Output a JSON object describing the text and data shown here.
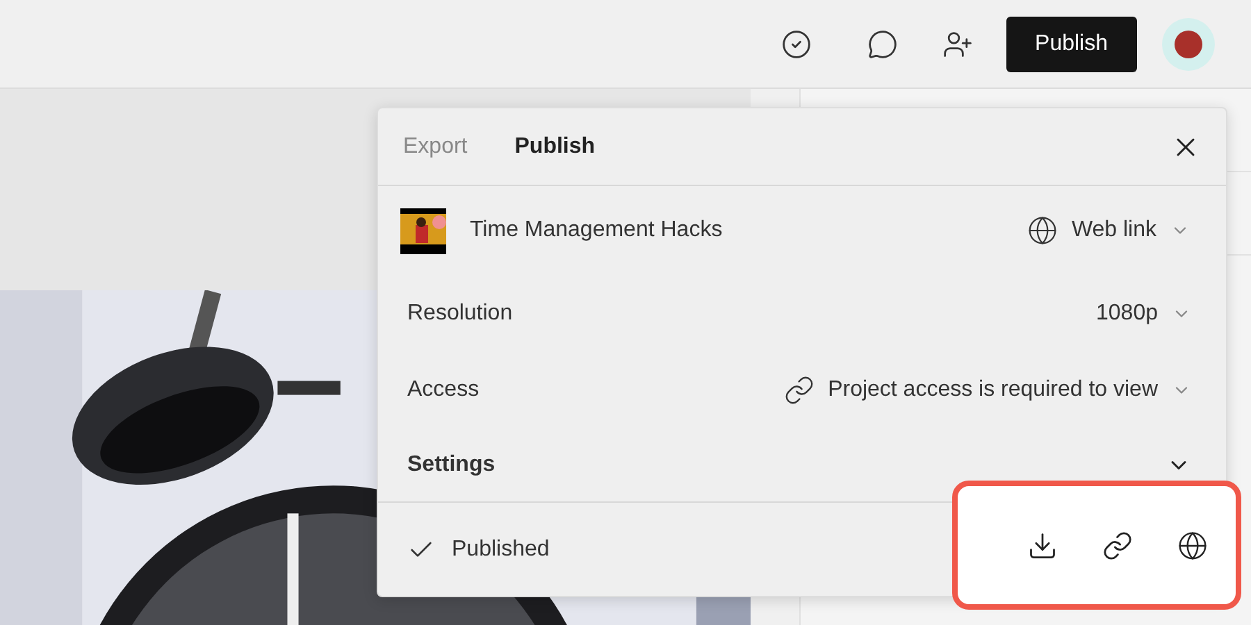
{
  "header": {
    "publish_button": "Publish"
  },
  "dialog": {
    "tabs": [
      {
        "label": "Export",
        "selected": false
      },
      {
        "label": "Publish",
        "selected": true
      }
    ],
    "video": {
      "title": "Time Management Hacks",
      "destination": "Web link"
    },
    "rows": [
      {
        "kind": "plain",
        "label": "Resolution",
        "value": "1080p"
      },
      {
        "kind": "link",
        "label": "Access",
        "value": "Project access is required to view"
      }
    ],
    "settings": {
      "label": "Settings",
      "expanded": false
    },
    "status": {
      "label": "Published",
      "done": true
    }
  }
}
